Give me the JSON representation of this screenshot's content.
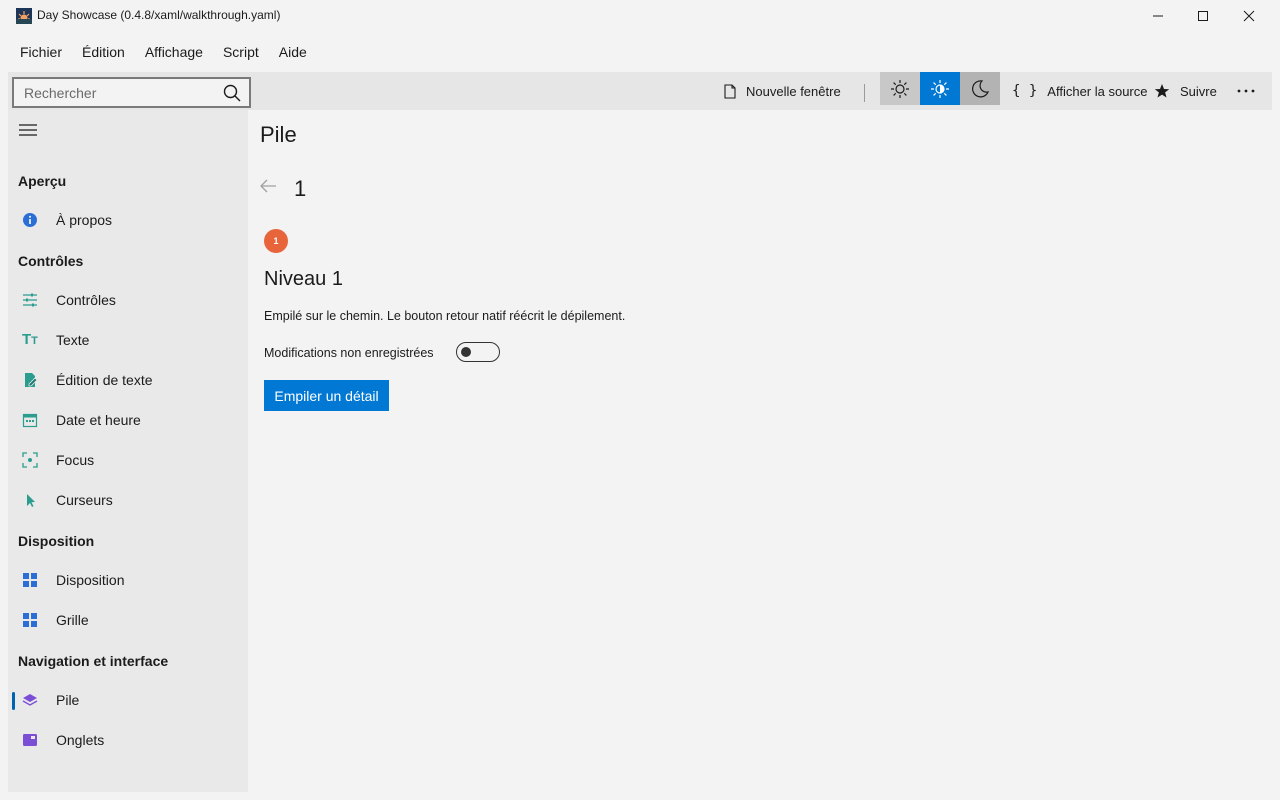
{
  "window": {
    "title": "Day Showcase (0.4.8/xaml/walkthrough.yaml)"
  },
  "menu": {
    "items": [
      "Fichier",
      "Édition",
      "Affichage",
      "Script",
      "Aide"
    ]
  },
  "toolbar": {
    "search_placeholder": "Rechercher",
    "new_window": "Nouvelle fenêtre",
    "view_source": "Afficher la source",
    "follow": "Suivre",
    "theme_selected": "auto"
  },
  "sidebar": {
    "sections": [
      {
        "title": "Aperçu",
        "items": [
          {
            "label": "À propos",
            "icon": "info-icon"
          }
        ]
      },
      {
        "title": "Contrôles",
        "items": [
          {
            "label": "Contrôles",
            "icon": "sliders-icon"
          },
          {
            "label": "Texte",
            "icon": "text-icon"
          },
          {
            "label": "Édition de texte",
            "icon": "edit-icon"
          },
          {
            "label": "Date et heure",
            "icon": "calendar-icon"
          },
          {
            "label": "Focus",
            "icon": "focus-icon"
          },
          {
            "label": "Curseurs",
            "icon": "cursor-icon"
          }
        ]
      },
      {
        "title": "Disposition",
        "items": [
          {
            "label": "Disposition",
            "icon": "layout-icon"
          },
          {
            "label": "Grille",
            "icon": "grid-icon"
          }
        ]
      },
      {
        "title": "Navigation et interface",
        "items": [
          {
            "label": "Pile",
            "icon": "stack-icon",
            "selected": true
          },
          {
            "label": "Onglets",
            "icon": "tabs-icon"
          }
        ]
      }
    ]
  },
  "main": {
    "page_title": "Pile",
    "breadcrumb": "1",
    "badge": "1",
    "level_title": "Niveau 1",
    "description": "Empilé sur le chemin. Le bouton retour natif réécrit le dépilement.",
    "toggle_label": "Modifications non enregistrées",
    "toggle_on": false,
    "push_button": "Empiler un détail"
  },
  "colors": {
    "accent": "#0078d4",
    "badge": "#e8643a",
    "icon_teal": "#2a9d8f",
    "icon_blue": "#2b6fd6",
    "icon_purple": "#7a4fd6"
  }
}
